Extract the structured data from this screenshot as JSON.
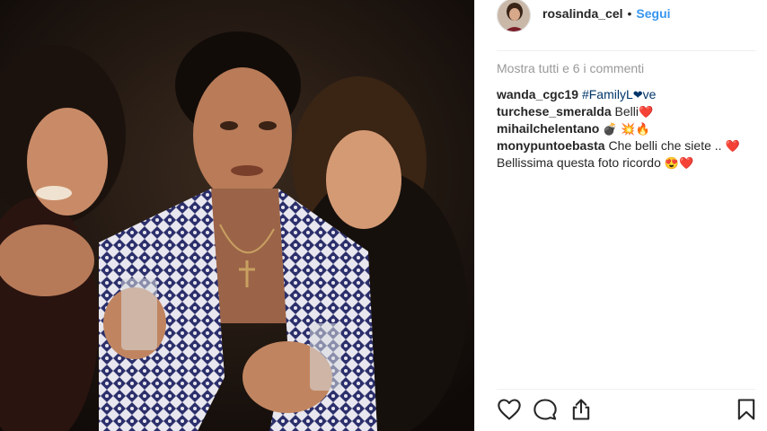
{
  "post": {
    "photo_icon": "vintage-family-photo",
    "author": {
      "username": "rosalinda_cel",
      "separator": "•",
      "follow_label": "Segui"
    },
    "load_more_label": "Mostra tutti e 6 i commenti",
    "comments": [
      {
        "author": "wanda_cgc19",
        "hashtag_prefix": "#FamilyL",
        "hashtag_suffix": "ve",
        "heart": "❤"
      },
      {
        "author": "turchese_smeralda",
        "text": "Belli",
        "heart": "❤️"
      },
      {
        "author": "mihailchelentano",
        "emoji_bomb": "💣",
        "emoji_burst": "💥",
        "emoji_fire": "🔥"
      },
      {
        "author": "monypuntoebasta",
        "text": "Che belli che siete .. ",
        "heart": "❤️",
        "text2": "Bellissima questa foto ricordo ",
        "emoji_smile": "😍",
        "heart2": "❤️"
      }
    ],
    "actions": {
      "like_icon": "heart-outline-icon",
      "comment_icon": "comment-bubble-icon",
      "share_icon": "share-upload-icon",
      "save_icon": "bookmark-icon"
    },
    "colors": {
      "follow": "#3897f0",
      "hashtag": "#003569",
      "muted": "#999999",
      "text": "#262626"
    }
  }
}
